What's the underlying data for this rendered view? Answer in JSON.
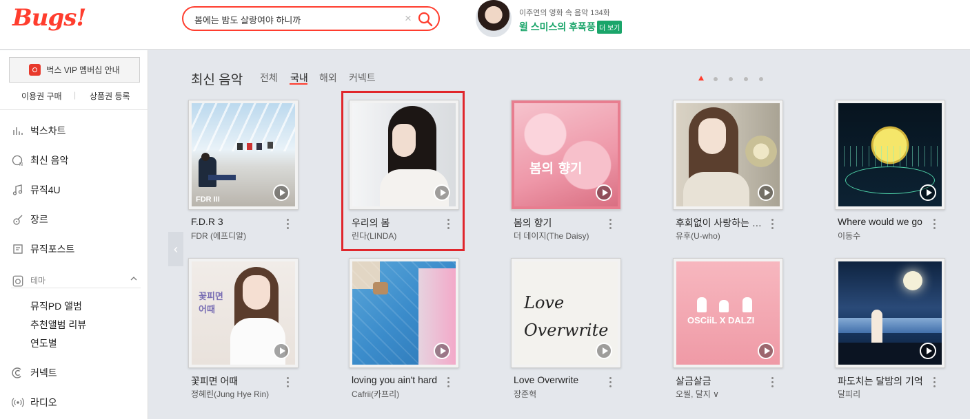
{
  "header": {
    "logo": "Bugs!",
    "search": {
      "value": "봄에는 밤도 살랑여야 하니까",
      "placeholder": ""
    },
    "promo": {
      "subtitle": "이주연의 영화 속 음악 134화",
      "title": "윌 스미스의 후폭풍",
      "more_label": "더 보기"
    }
  },
  "sidebar": {
    "vip_label": "벅스 VIP 멤버십 안내",
    "links": [
      "이용권 구매",
      "상품권 등록"
    ],
    "nav": [
      {
        "label": "벅스차트",
        "icon": "chart-bars-icon"
      },
      {
        "label": "최신 음악",
        "icon": "new-music-icon"
      },
      {
        "label": "뮤직4U",
        "icon": "music-note-icon"
      },
      {
        "label": "장르",
        "icon": "guitar-icon"
      },
      {
        "label": "뮤직포스트",
        "icon": "post-icon"
      }
    ],
    "theme": {
      "label": "테마",
      "icon": "theme-icon",
      "items": [
        "뮤직PD 앨범",
        "추천앨범 리뷰",
        "연도별"
      ]
    },
    "nav_bottom": [
      {
        "label": "커넥트",
        "icon": "connect-icon"
      },
      {
        "label": "라디오",
        "icon": "radio-icon"
      }
    ]
  },
  "main": {
    "section_title": "최신 음악",
    "tabs": [
      "전체",
      "국내",
      "해외",
      "커넥트"
    ],
    "active_tab": "국내",
    "page_count": 5,
    "active_page": 1,
    "albums": [
      {
        "title": "F.D.R 3",
        "artist": "FDR (에프디알)",
        "cover_text": "FDR III"
      },
      {
        "title": "우리의 봄",
        "artist": "린다(LINDA)",
        "cover_text": ""
      },
      {
        "title": "봄의 향기",
        "artist": "더 데이지(The Daisy)",
        "cover_text": "봄의 향기"
      },
      {
        "title": "후회없이 사랑하는 방법",
        "artist": "유후(U-who)",
        "cover_text": ""
      },
      {
        "title": "Where would we go",
        "artist": "이동수",
        "cover_text": ""
      },
      {
        "title": "꽃피면 어때",
        "artist": "정혜린(Jung Hye Rin)",
        "cover_text": "꽃피면 어때"
      },
      {
        "title": "loving you ain't hard",
        "artist": "Cafrii(카프리)",
        "cover_text": ""
      },
      {
        "title": "Love Overwrite",
        "artist": "장준혁",
        "cover_text": "Love Overwrite"
      },
      {
        "title": "살금살금",
        "artist": "오씰, 달지 ∨",
        "cover_text": "OSCiiL X DALZI"
      },
      {
        "title": "파도치는 달밤의 기억",
        "artist": "달피리",
        "cover_text": ""
      }
    ]
  },
  "colors": {
    "brand": "#ff3d2e",
    "promo_green": "#1aa56a",
    "highlight": "#e0262c"
  }
}
